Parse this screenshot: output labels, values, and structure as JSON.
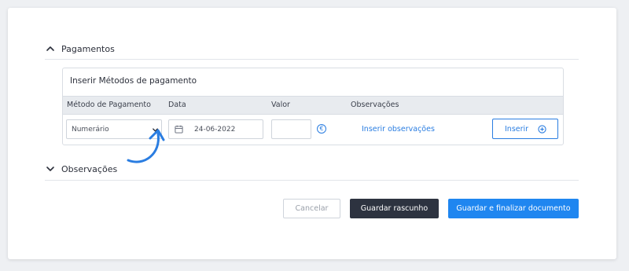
{
  "sections": {
    "payments_title": "Pagamentos",
    "observations_title": "Observações"
  },
  "panel": {
    "title": "Inserir Métodos de pagamento",
    "columns": {
      "method": "Método de Pagamento",
      "date": "Data",
      "value": "Valor",
      "observations": "Observações"
    },
    "row": {
      "method_selected": "Numerário",
      "date_value": "24-06-2022",
      "value_input": "",
      "currency_symbol": "€",
      "observations_link": "Inserir observações",
      "insert_label": "Inserir"
    }
  },
  "actions": {
    "cancel": "Cancelar",
    "save_draft": "Guardar rascunho",
    "save_finalize": "Guardar e finalizar documento"
  },
  "colors": {
    "accent": "#2a7de1",
    "primary_button": "#1f86f0",
    "dark_button": "#2d3340",
    "annotation_arrow": "#2a7de1"
  },
  "icons": {
    "section_open": "chevron-up-icon",
    "section_closed": "chevron-down-icon",
    "date": "calendar-icon",
    "currency": "euro-icon",
    "insert": "plus-circle-icon",
    "annotation": "curved-arrow-icon"
  }
}
